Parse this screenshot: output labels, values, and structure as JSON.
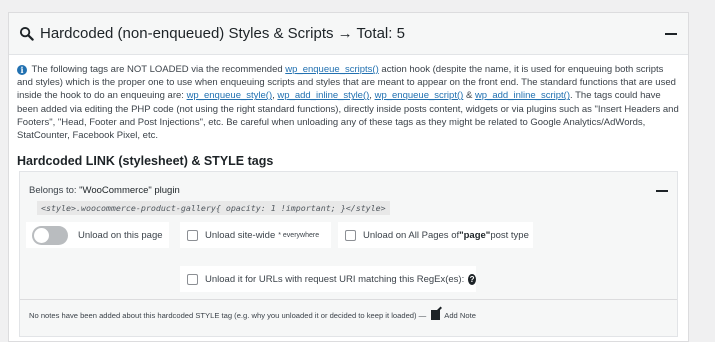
{
  "header": {
    "title": "Hardcoded (non-enqueued) Styles & Scripts → Total: 5",
    "icon": "search-icon"
  },
  "info": {
    "t1": "The following tags are NOT LOADED via the recommended ",
    "l1": "wp_enqueue_scripts()",
    "t2": " action hook (despite the name, it is used for enqueuing both scripts and styles) which is the proper one to use when enqueuing scripts and styles that are meant to appear on the front end. The standard functions that are used inside the hook to do an enqueuing are: ",
    "l2": "wp_enqueue_style()",
    "t3": ", ",
    "l3": "wp_add_inline_style()",
    "t4": ", ",
    "l4": "wp_enqueue_script()",
    "t5": " & ",
    "l5": "wp_add_inline_script()",
    "t6": ". The tags could have been added via editing the PHP code (not using the right standard functions), directly inside posts content, widgets or via plugins such as \"Insert Headers and Footers\", \"Head, Footer and Post Injections\", etc. Be careful when unloading any of these tags as they might be related to Google Analytics/AdWords, StatCounter, Facebook Pixel, etc."
  },
  "section_title": "Hardcoded LINK (stylesheet) & STYLE tags",
  "tag": {
    "belongs_label": "Belongs to: ",
    "plugin": "\"WooCommerce\" plugin",
    "code": "<style>.woocommerce-product-gallery{ opacity: 1 !important; }</style>"
  },
  "options": {
    "unload_page": "Unload on this page",
    "unload_site": "Unload site-wide",
    "everywhere": "* everywhere",
    "unload_all_pre": "Unload on All Pages of ",
    "post_type": "\"page\"",
    "unload_all_post": " post type",
    "unload_regex": "Unload it for URLs with request URI matching this RegEx(es):",
    "help": "?"
  },
  "notes": {
    "text": "No notes have been added about this hardcoded STYLE tag (e.g. why you unloaded it or decided to keep it loaded) —",
    "add_note": "Add Note"
  }
}
